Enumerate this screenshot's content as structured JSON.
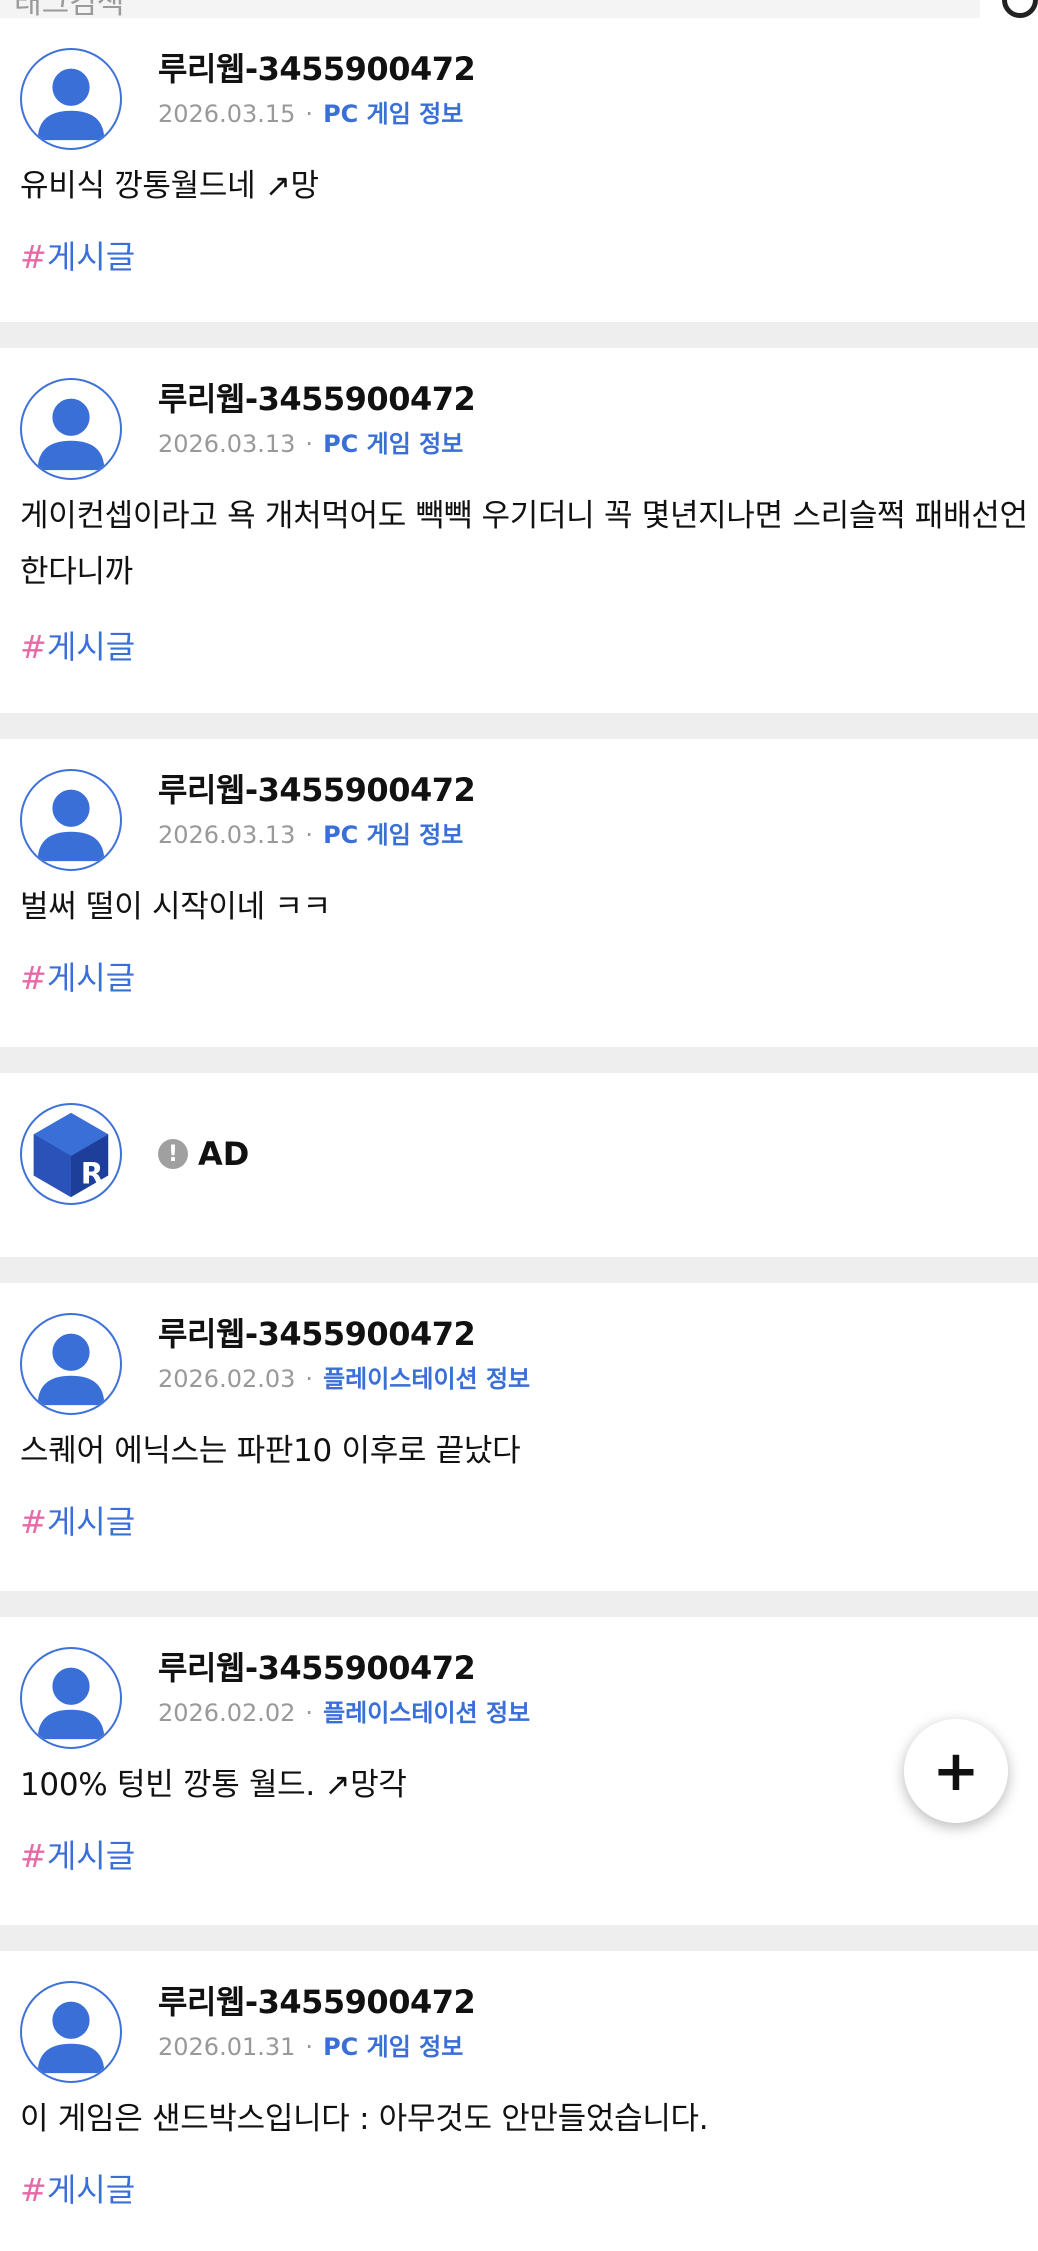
{
  "top_cut_text": "태그검색",
  "posts": [
    {
      "author": "루리웹-3455900472",
      "date": "2026.03.15",
      "category": "PC 게임 정보",
      "body": "유비식 깡통월드네 ↗망",
      "tag_hash": "#",
      "tag": "게시글"
    },
    {
      "author": "루리웹-3455900472",
      "date": "2026.03.13",
      "category": "PC 게임 정보",
      "body": "게이컨셉이라고 욕 개처먹어도 빽빽 우기더니 꼭 몇년지나면 스리슬쩍 패배선언한다니까",
      "tag_hash": "#",
      "tag": "게시글"
    },
    {
      "author": "루리웹-3455900472",
      "date": "2026.03.13",
      "category": "PC 게임 정보",
      "body": "벌써 떨이 시작이네 ㅋㅋ",
      "tag_hash": "#",
      "tag": "게시글"
    },
    {
      "author": "루리웹-3455900472",
      "date": "2026.02.03",
      "category": "플레이스테이션 정보",
      "body": "스퀘어 에닉스는 파판10 이후로 끝났다",
      "tag_hash": "#",
      "tag": "게시글"
    },
    {
      "author": "루리웹-3455900472",
      "date": "2026.02.02",
      "category": "플레이스테이션 정보",
      "body": "100% 텅빈 깡통 월드. ↗망각",
      "tag_hash": "#",
      "tag": "게시글"
    },
    {
      "author": "루리웹-3455900472",
      "date": "2026.01.31",
      "category": "PC 게임 정보",
      "body": "이 게임은 샌드박스입니다 : 아무것도 안만들었습니다.",
      "tag_hash": "#",
      "tag": "게시글"
    }
  ],
  "ad": {
    "badge_icon": "!",
    "label": "AD",
    "logo_letter": "R"
  },
  "separator": "·",
  "fab": {
    "label": "+"
  },
  "colors": {
    "accent": "#3a6fd8",
    "hash": "#e66aa6",
    "divider": "#eeeeee"
  }
}
